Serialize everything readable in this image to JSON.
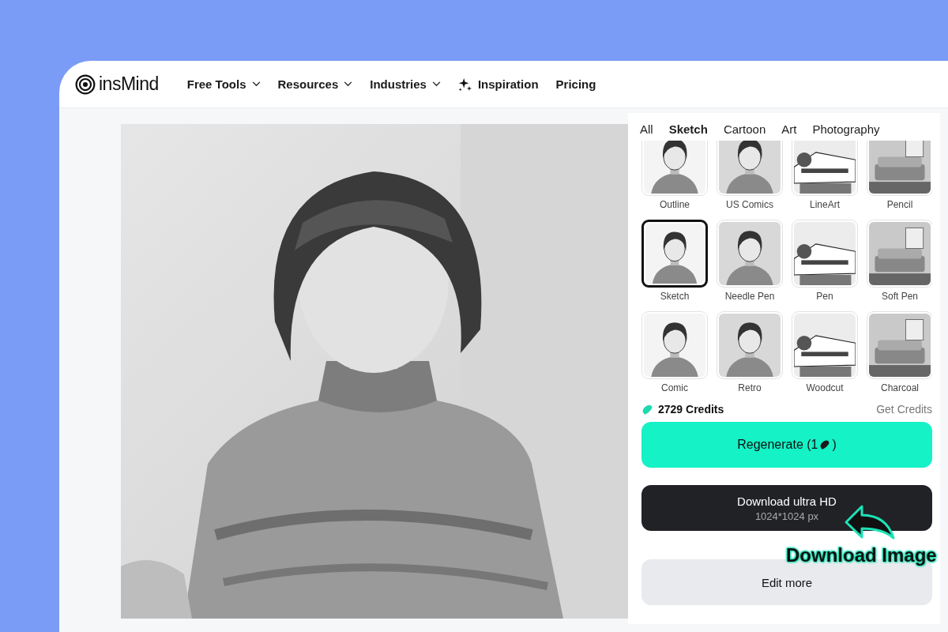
{
  "header": {
    "logo": "insMind",
    "nav": [
      {
        "label": "Free Tools",
        "kind": "dropdown"
      },
      {
        "label": "Resources",
        "kind": "dropdown"
      },
      {
        "label": "Industries",
        "kind": "dropdown"
      },
      {
        "label": "Inspiration",
        "kind": "sparkle"
      },
      {
        "label": "Pricing",
        "kind": "link"
      }
    ]
  },
  "style_panel": {
    "tabs": [
      {
        "label": "All",
        "selected": false
      },
      {
        "label": "Sketch",
        "selected": true
      },
      {
        "label": "Cartoon",
        "selected": false
      },
      {
        "label": "Art",
        "selected": false
      },
      {
        "label": "Photography",
        "selected": false
      }
    ],
    "styles": [
      {
        "label": "Outline",
        "selected": false
      },
      {
        "label": "US Comics",
        "selected": false
      },
      {
        "label": "LineArt",
        "selected": false
      },
      {
        "label": "Pencil",
        "selected": false
      },
      {
        "label": "Sketch",
        "selected": true
      },
      {
        "label": "Needle Pen",
        "selected": false
      },
      {
        "label": "Pen",
        "selected": false
      },
      {
        "label": "Soft Pen",
        "selected": false
      },
      {
        "label": "Comic",
        "selected": false
      },
      {
        "label": "Retro",
        "selected": false
      },
      {
        "label": "Woodcut",
        "selected": false
      },
      {
        "label": "Charcoal",
        "selected": false
      }
    ],
    "credits": "2729 Credits",
    "get_credits": "Get Credits",
    "regenerate": {
      "label": "Regenerate (1",
      "close": ")"
    },
    "download": {
      "label": "Download ultra HD",
      "size": "1024*1024 px"
    },
    "edit_more": "Edit more"
  },
  "annotation": {
    "label": "Download Image"
  }
}
